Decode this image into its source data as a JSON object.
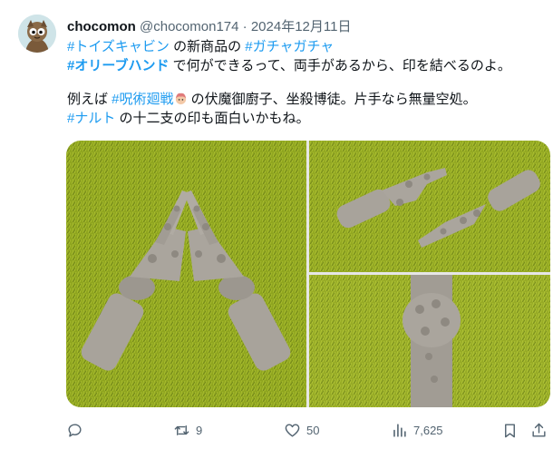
{
  "tweet": {
    "author_name": "chocomon",
    "handle": "@chocomon174",
    "separator": " · ",
    "date": "2024年12月11日",
    "line1": {
      "tag1": "#トイズキャビン",
      "text1": " の新商品の ",
      "tag2": "#ガチャガチャ"
    },
    "line2": {
      "tag": "#オリーブハンド",
      "text": " で何ができるって、両手があるから、印を結べるのよ。"
    },
    "line3": {
      "text1": "例えば ",
      "tag": "#呪術廻戦",
      "emoji": "character-face-emoji",
      "text2": " の伏魔御廚子、坐殺博徒。片手なら無量空処。"
    },
    "line4": {
      "tag": "#ナルト",
      "text": " の十二支の印も面白いかもね。"
    }
  },
  "actions": {
    "reply": {
      "icon": "reply-icon",
      "count": ""
    },
    "retweet": {
      "icon": "retweet-icon",
      "count": "9"
    },
    "like": {
      "icon": "heart-icon",
      "count": "50"
    },
    "views": {
      "icon": "views-icon",
      "count": "7,625"
    },
    "bookmark": {
      "icon": "bookmark-icon"
    },
    "share": {
      "icon": "share-icon"
    }
  },
  "colors": {
    "text": "#0f1419",
    "secondary": "#536471",
    "link": "#1d9bf0",
    "grass": "#8fa51f",
    "figure": "#a8a39b"
  }
}
